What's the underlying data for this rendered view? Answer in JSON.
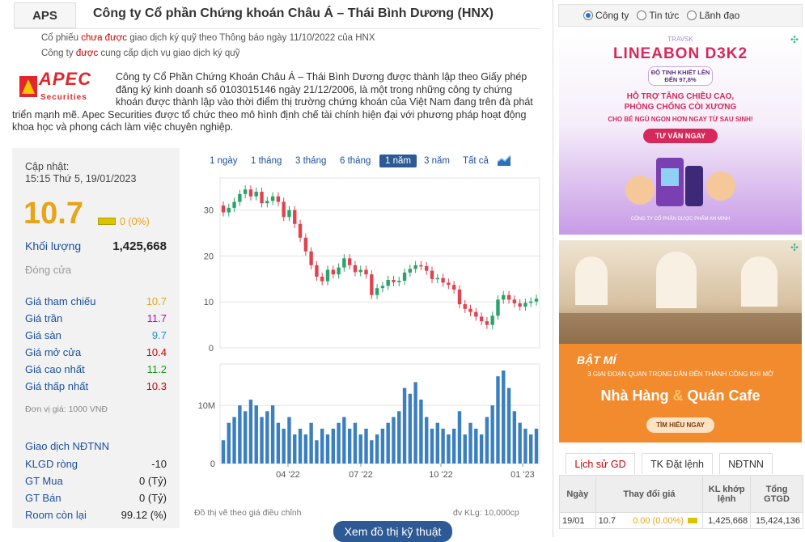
{
  "header": {
    "ticker": "APS",
    "company_name": "Công ty Cổ phần Chứng khoán Châu Á – Thái Bình Dương (HNX)",
    "margin_note_prefix": "Cổ phiếu ",
    "margin_note_red": "chưa được",
    "margin_note_suffix": " giao dịch ký quỹ theo Thông báo ngày 11/10/2022 của HNX",
    "service_note_prefix": "Công ty ",
    "service_note_red": "được",
    "service_note_suffix": " cung cấp dịch vụ giao dịch ký quỹ"
  },
  "logo": {
    "main": "APEC",
    "sub": "Securities"
  },
  "intro": "Công ty Cổ Phần Chứng Khoán Châu Á – Thái Bình Dương được thành lập theo Giấy phép đăng ký kinh doanh số 0103015146 ngày 21/12/2006, là một trong những công ty chứng khoán được thành lập vào thời điểm thị trường chứng khoán của Việt Nam đang trên đà phát triển mạnh mẽ. Apec Securities được tổ chức theo mô hình định chế tài chính hiện đại với phương pháp hoạt động khoa học và phong cách làm việc chuyên nghiệp.",
  "quote": {
    "updated_label": "Cập nhật:",
    "updated_time": "15:15 Thứ 5, 19/01/2023",
    "price": "10.7",
    "change": "0 (0%)",
    "volume_label": "Khối lượng",
    "volume": "1,425,668",
    "status": "Đóng cửa",
    "stats": [
      {
        "label": "Giá tham chiếu",
        "value": "10.7",
        "color": "#e8a317"
      },
      {
        "label": "Giá trần",
        "value": "11.7",
        "color": "#c800c8"
      },
      {
        "label": "Giá sàn",
        "value": "9.7",
        "color": "#1a8fd6"
      },
      {
        "label": "Giá mở cửa",
        "value": "10.4",
        "color": "#d00000"
      },
      {
        "label": "Giá cao nhất",
        "value": "11.2",
        "color": "#1b9a1b"
      },
      {
        "label": "Giá thấp nhất",
        "value": "10.3",
        "color": "#d00000"
      }
    ],
    "unit_note": "Đơn vị giá: 1000 VNĐ",
    "foreign_title": "Giao dịch NĐTNN",
    "foreign": [
      {
        "label": "KLGD ròng",
        "value": "-10"
      },
      {
        "label": "GT Mua",
        "value": "0 (Tỷ)"
      },
      {
        "label": "GT Bán",
        "value": "0 (Tỷ)"
      },
      {
        "label": "Room còn lại",
        "value": "99.12 (%)"
      }
    ]
  },
  "chart_ranges": [
    "1 ngày",
    "1 tháng",
    "3 tháng",
    "6 tháng",
    "1 năm",
    "3 năm",
    "Tất cả"
  ],
  "chart_active_range": "1 năm",
  "chart_data": {
    "type": "candlestick",
    "price_axis": {
      "ticks": [
        "30",
        "20",
        "10",
        "0"
      ],
      "ylim": [
        0,
        37
      ]
    },
    "volume_axis": {
      "ticks": [
        "10M",
        "0"
      ]
    },
    "x_ticks": [
      "04 '22",
      "07 '22",
      "10 '22",
      "01 '23"
    ],
    "close": [
      29.5,
      30.5,
      31.8,
      33.5,
      34.5,
      33,
      34,
      31.5,
      32,
      33,
      31.8,
      28.5,
      30,
      27,
      24,
      21,
      18,
      15.5,
      14.5,
      17,
      16,
      17.5,
      19.5,
      18,
      16.5,
      17,
      16,
      11.5,
      13,
      13.5,
      14.8,
      14.3,
      14.6,
      16.4,
      17.2,
      18,
      17.8,
      16.8,
      15,
      15.2,
      14.2,
      13.7,
      12.7,
      9.5,
      8.5,
      7.8,
      6.8,
      5.8,
      5,
      7,
      10.5,
      11.5,
      10.5,
      9.7,
      9,
      9.8,
      10.1,
      10.7
    ],
    "volume_m": [
      4,
      7,
      8,
      10,
      9,
      11,
      10,
      8,
      9,
      10,
      7,
      6,
      8,
      5,
      6,
      5,
      7,
      4,
      6,
      5,
      6,
      7,
      8,
      6,
      7,
      5,
      6,
      4,
      5,
      6,
      7,
      8,
      9,
      13,
      12,
      14,
      11,
      8,
      6,
      7,
      6,
      5,
      6,
      9,
      5,
      7,
      6,
      5,
      8,
      10,
      15,
      16,
      13,
      9,
      7,
      6,
      5,
      6
    ],
    "note": "Đồ thị vẽ theo giá điều chỉnh",
    "volume_unit": "đv KLg: 10,000cp"
  },
  "tech_button": "Xem đồ thị kỹ thuật",
  "search_options": [
    "Công ty",
    "Tin tức",
    "Lãnh đạo"
  ],
  "search_selected": "Công ty",
  "ad1": {
    "brand": "TRAVSK",
    "product": "LINEABON D3K2",
    "badge": "ĐỘ TINH KHIẾT LÊN ĐẾN 97,8%",
    "headline": "HỖ TRỢ TĂNG CHIỀU CAO, PHÒNG CHỐNG CÒI XƯƠNG",
    "sub": "CHO BÉ NGỦ NGON HƠN NGAY TỪ SAU SINH!",
    "cta": "TƯ VẤN NGAY",
    "company": "CÔNG TY CỔ PHẦN DƯỢC PHẨM AN MINH"
  },
  "ad2": {
    "kicker": "BẬT MÍ",
    "line": "3 GIAI ĐOẠN QUAN TRỌNG DẪN ĐẾN THÀNH CÔNG KHI MỞ",
    "title_a": "Nhà Hàng",
    "amp": "&",
    "title_b": "Quán Cafe",
    "cta": "TÌM HIỂU NGAY"
  },
  "tabs": [
    "Lịch sử GD",
    "TK Đặt lệnh",
    "NĐTNN"
  ],
  "table": {
    "headers": [
      "Ngày",
      "Thay đổi giá",
      "KL khớp lệnh",
      "Tổng GTGD"
    ],
    "rows": [
      {
        "date": "19/01",
        "price": "10.7",
        "change": "0.00 (0.00%)",
        "volume": "1,425,668",
        "value": "15,424,136"
      }
    ]
  }
}
